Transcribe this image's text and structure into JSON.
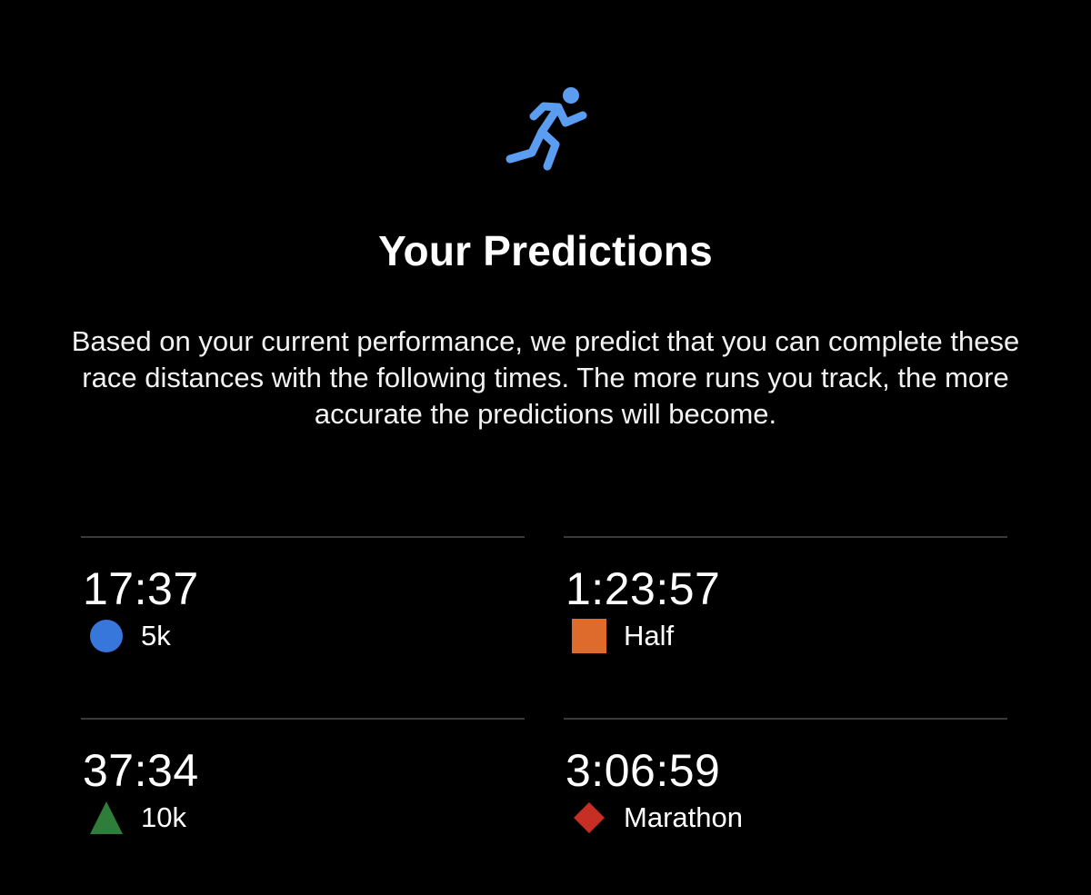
{
  "header": {
    "icon": "running-figure-icon",
    "icon_color": "#5b9df0",
    "title": "Your Predictions"
  },
  "description": "Based on your current performance, we predict that you can complete these race distances with the following times. The more runs you track, the more accurate the predictions will become.",
  "predictions": [
    {
      "time": "17:37",
      "label": "5k",
      "marker": "circle-marker-icon",
      "color": "#3777db"
    },
    {
      "time": "1:23:57",
      "label": "Half",
      "marker": "square-marker-icon",
      "color": "#de6a2c"
    },
    {
      "time": "37:34",
      "label": "10k",
      "marker": "triangle-marker-icon",
      "color": "#2f7d3a"
    },
    {
      "time": "3:06:59",
      "label": "Marathon",
      "marker": "diamond-marker-icon",
      "color": "#c82f24"
    }
  ]
}
